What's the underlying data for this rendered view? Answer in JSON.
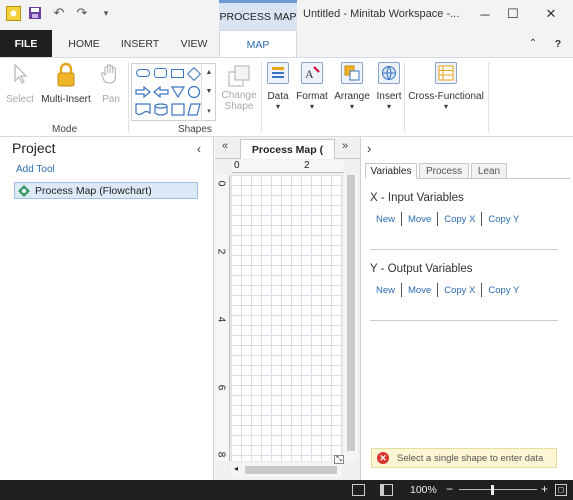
{
  "window": {
    "context_tab_header": "PROCESS MAP",
    "title": "Untitled - Minitab Workspace -..."
  },
  "quick_access": {
    "icons": [
      "app-logo-icon",
      "save-icon",
      "undo-icon",
      "redo-icon",
      "customize-icon"
    ]
  },
  "ribbon_tabs": [
    "FILE",
    "HOME",
    "INSERT",
    "VIEW",
    "MAP"
  ],
  "ribbon": {
    "mode_group": {
      "label": "Mode",
      "select": "Select",
      "multi_insert": "Multi-Insert",
      "pan": "Pan"
    },
    "shapes_group": {
      "label": "Shapes",
      "change_shape_line1": "Change",
      "change_shape_line2": "Shape"
    },
    "buttons": {
      "data": "Data",
      "format": "Format",
      "arrange": "Arrange",
      "insert": "Insert",
      "cross_functional": "Cross-Functional"
    }
  },
  "project": {
    "title": "Project",
    "add_tool": "Add Tool",
    "item": "Process Map (Flowchart)"
  },
  "map": {
    "tab_label": "Process Map (",
    "ruler_top": [
      "0",
      "2"
    ],
    "ruler_left": [
      "0",
      "2",
      "4",
      "6",
      "8"
    ]
  },
  "right_pane": {
    "tabs": [
      "Variables",
      "Process",
      "Lean"
    ],
    "active_tab": "Variables",
    "input_section": {
      "title": "X - Input Variables",
      "actions": [
        "New",
        "Move",
        "Copy X",
        "Copy Y"
      ]
    },
    "output_section": {
      "title": "Y - Output Variables",
      "actions": [
        "New",
        "Move",
        "Copy X",
        "Copy Y"
      ]
    },
    "status_message": "Select a single shape to enter data"
  },
  "statusbar": {
    "zoom": "100%"
  },
  "colors": {
    "accent": "#2b6cb0",
    "file_tab_bg": "#1f1f1f",
    "error": "#d9342b"
  }
}
